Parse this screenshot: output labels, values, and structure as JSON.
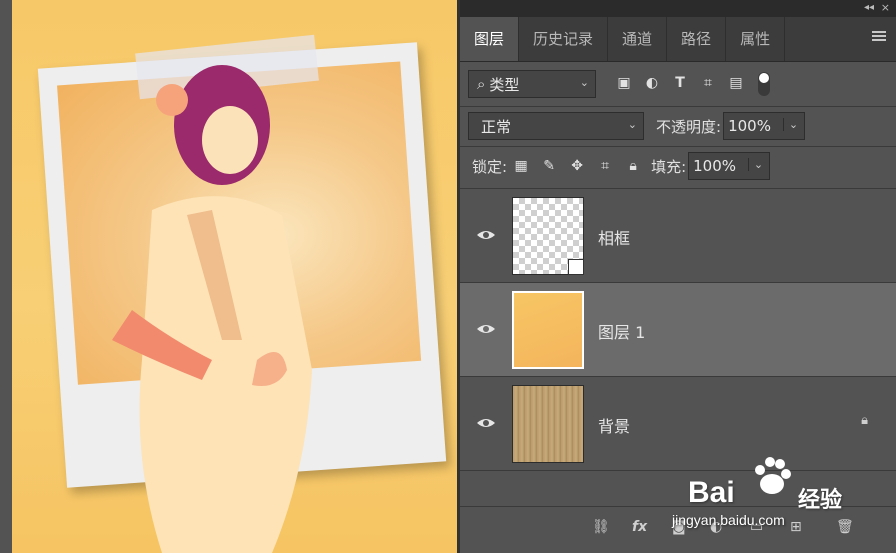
{
  "panel": {
    "tabs": [
      {
        "label": "图层",
        "active": true
      },
      {
        "label": "历史记录",
        "active": false
      },
      {
        "label": "通道",
        "active": false
      },
      {
        "label": "路径",
        "active": false
      },
      {
        "label": "属性",
        "active": false
      }
    ],
    "filter": {
      "label": "类型"
    },
    "blend_mode": "正常",
    "opacity_label": "不透明度:",
    "opacity_value": "100%",
    "lock_label": "锁定:",
    "fill_label": "填充:",
    "fill_value": "100%"
  },
  "layers": [
    {
      "name": "相框",
      "visible": true,
      "selected": false,
      "thumbnail": "checker-transparent",
      "smart_object": true
    },
    {
      "name": "图层 1",
      "visible": true,
      "selected": true,
      "thumbnail": "photo"
    },
    {
      "name": "背景",
      "visible": true,
      "selected": false,
      "thumbnail": "wood",
      "locked": true
    }
  ],
  "bottom_icons": [
    "link-icon",
    "fx-icon",
    "mask-icon",
    "adjustment-icon",
    "group-icon",
    "new-layer-icon",
    "trash-icon"
  ],
  "watermark": {
    "brand": "Bai",
    "brand2": "经验",
    "url": "jingyan.baidu.com"
  },
  "colors": {
    "panel_bg": "#535353",
    "selected_row": "#6b6b6b",
    "tab_bar": "#3c3c3c",
    "photo_tint": "#f7c867"
  }
}
